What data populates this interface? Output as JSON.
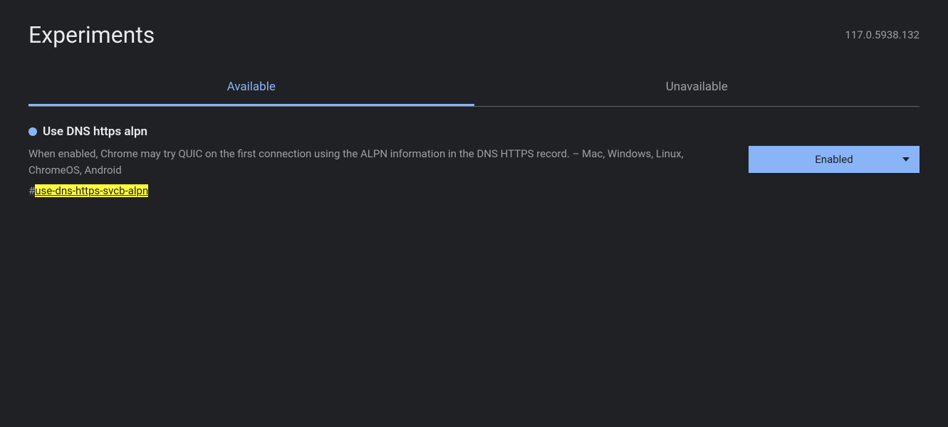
{
  "header": {
    "title": "Experiments",
    "version": "117.0.5938.132"
  },
  "tabs": {
    "available": "Available",
    "unavailable": "Unavailable"
  },
  "flag": {
    "title": "Use DNS https alpn",
    "description": "When enabled, Chrome may try QUIC on the first connection using the ALPN information in the DNS HTTPS record. – Mac, Windows, Linux, ChromeOS, Android",
    "anchor_hash": "#",
    "anchor_text": "use-dns-https-svcb-alpn",
    "dropdown_value": "Enabled"
  }
}
